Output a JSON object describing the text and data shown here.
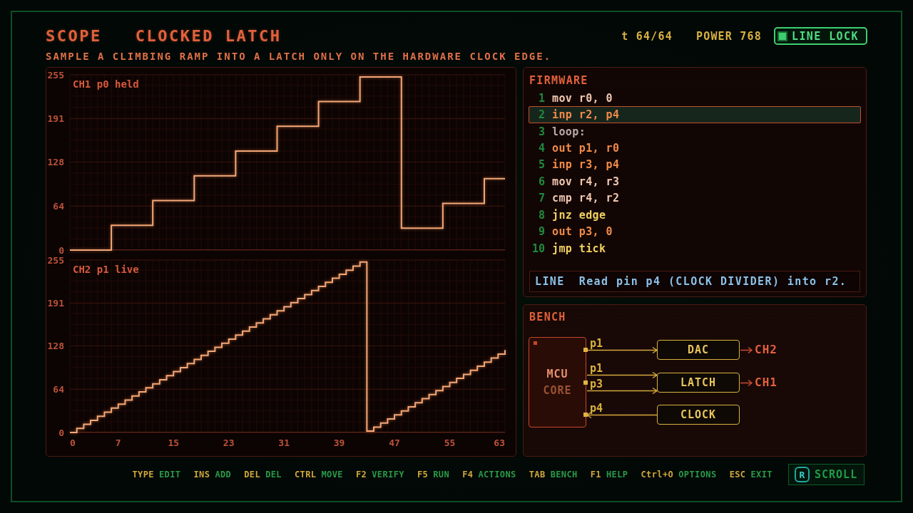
{
  "header": {
    "mode": "SCOPE",
    "title": "CLOCKED LATCH",
    "subtitle": "SAMPLE A CLIMBING RAMP INTO A LATCH ONLY ON THE HARDWARE CLOCK EDGE.",
    "tick": "t 64/64",
    "power": "POWER 768",
    "line_lock": {
      "label": "LINE LOCK",
      "on": true
    }
  },
  "scope": {
    "channels": [
      {
        "chart_data": {
          "type": "line",
          "title": "CH1 p0 held",
          "x": [
            0,
            6,
            6,
            12,
            12,
            18,
            18,
            24,
            24,
            30,
            30,
            36,
            36,
            42,
            42,
            48,
            48,
            54,
            54,
            60,
            60,
            63
          ],
          "series": [
            {
              "color": "#f4a878",
              "values": [
                0,
                0,
                36,
                36,
                72,
                72,
                108,
                108,
                144,
                144,
                180,
                180,
                216,
                216,
                252,
                252,
                32,
                32,
                68,
                68,
                104,
                104
              ]
            }
          ],
          "xlim": [
            0,
            63
          ],
          "ylim": [
            0,
            255
          ],
          "yticks": [
            0,
            64,
            128,
            191,
            255
          ],
          "grid": true
        }
      },
      {
        "chart_data": {
          "type": "line",
          "title": "CH2 p1 live",
          "x": [
            0,
            1,
            1,
            2,
            2,
            3,
            3,
            4,
            4,
            5,
            5,
            6,
            6,
            7,
            7,
            8,
            8,
            9,
            9,
            10,
            10,
            11,
            11,
            12,
            12,
            13,
            13,
            14,
            14,
            15,
            15,
            16,
            16,
            17,
            17,
            18,
            18,
            19,
            19,
            20,
            20,
            21,
            21,
            22,
            22,
            23,
            23,
            24,
            24,
            25,
            25,
            26,
            26,
            27,
            27,
            28,
            28,
            29,
            29,
            30,
            30,
            31,
            31,
            32,
            32,
            33,
            33,
            34,
            34,
            35,
            35,
            36,
            36,
            37,
            37,
            38,
            38,
            39,
            39,
            40,
            40,
            41,
            41,
            42,
            42,
            43,
            43,
            44,
            44,
            45,
            45,
            46,
            46,
            47,
            47,
            48,
            48,
            49,
            49,
            50,
            50,
            51,
            51,
            52,
            52,
            53,
            53,
            54,
            54,
            55,
            55,
            56,
            56,
            57,
            57,
            58,
            58,
            59,
            59,
            60,
            60,
            61,
            61,
            62,
            62,
            63,
            63
          ],
          "series": [
            {
              "color": "#f4a878",
              "values": [
                0,
                0,
                6,
                6,
                12,
                12,
                18,
                18,
                24,
                24,
                30,
                30,
                36,
                36,
                42,
                42,
                48,
                48,
                54,
                54,
                60,
                60,
                66,
                66,
                72,
                72,
                78,
                78,
                84,
                84,
                90,
                90,
                96,
                96,
                102,
                102,
                108,
                108,
                114,
                114,
                120,
                120,
                126,
                126,
                132,
                132,
                138,
                138,
                144,
                144,
                150,
                150,
                156,
                156,
                162,
                162,
                168,
                168,
                174,
                174,
                180,
                180,
                186,
                186,
                192,
                192,
                198,
                198,
                204,
                204,
                210,
                210,
                216,
                216,
                222,
                222,
                228,
                228,
                234,
                234,
                240,
                240,
                246,
                246,
                252,
                252,
                2,
                2,
                8,
                8,
                14,
                14,
                20,
                20,
                26,
                26,
                32,
                32,
                38,
                38,
                44,
                44,
                50,
                50,
                56,
                56,
                62,
                62,
                68,
                68,
                74,
                74,
                80,
                80,
                86,
                86,
                92,
                92,
                98,
                98,
                104,
                104,
                110,
                110,
                116,
                116,
                122
              ]
            }
          ],
          "xlim": [
            0,
            63
          ],
          "ylim": [
            0,
            255
          ],
          "yticks": [
            0,
            64,
            128,
            191,
            255
          ],
          "xticks": [
            0,
            7,
            15,
            23,
            31,
            39,
            47,
            55,
            63
          ],
          "grid": true
        }
      }
    ]
  },
  "firmware": {
    "title": "FIRMWARE",
    "lines": [
      {
        "number": "1",
        "code": "mov r0, 0",
        "kind": "data",
        "selected": false
      },
      {
        "number": "2",
        "code": "inp r2, p4",
        "kind": "io",
        "selected": true
      },
      {
        "number": "3",
        "code": "loop:",
        "kind": "label",
        "selected": false
      },
      {
        "number": "4",
        "code": "out p1, r0",
        "kind": "io",
        "selected": false
      },
      {
        "number": "5",
        "code": "inp r3, p4",
        "kind": "io",
        "selected": false
      },
      {
        "number": "6",
        "code": "mov r4, r3",
        "kind": "data",
        "selected": false
      },
      {
        "number": "7",
        "code": "cmp r4, r2",
        "kind": "data",
        "selected": false
      },
      {
        "number": "8",
        "code": "jnz edge",
        "kind": "branch",
        "selected": false
      },
      {
        "number": "9",
        "code": "out p3, 0",
        "kind": "io",
        "selected": false
      },
      {
        "number": "10",
        "code": "jmp tick",
        "kind": "branch",
        "selected": false
      }
    ],
    "hint": {
      "tag": "LINE",
      "text": "Read pin p4 (CLOCK DIVIDER) into r2."
    }
  },
  "bench": {
    "title": "BENCH",
    "core": {
      "name": "MCU",
      "subtitle": "CORE"
    },
    "blocks": [
      {
        "label": "DAC",
        "output": "CH2",
        "wires": [
          {
            "pin": "p1",
            "incoming": false
          }
        ]
      },
      {
        "label": "LATCH",
        "output": "CH1",
        "wires": [
          {
            "pin": "p1",
            "incoming": false
          },
          {
            "pin": "p3",
            "incoming": false
          }
        ]
      },
      {
        "label": "CLOCK",
        "wires": [
          {
            "pin": "p4",
            "incoming": true
          }
        ]
      }
    ]
  },
  "footer": {
    "shortcuts": [
      {
        "key": "TYPE",
        "action": "EDIT"
      },
      {
        "key": "INS",
        "action": "ADD"
      },
      {
        "key": "DEL",
        "action": "DEL"
      },
      {
        "key": "CTRL",
        "action": "MOVE"
      },
      {
        "key": "F2",
        "action": "VERIFY"
      },
      {
        "key": "F5",
        "action": "RUN"
      },
      {
        "key": "F4",
        "action": "ACTIONS"
      },
      {
        "key": "TAB",
        "action": "BENCH"
      },
      {
        "key": "F1",
        "action": "HELP"
      },
      {
        "key": "Ctrl+O",
        "action": "OPTIONS"
      },
      {
        "key": "ESC",
        "action": "EXIT"
      }
    ],
    "scroll_button": {
      "key": "R",
      "label": "SCROLL"
    }
  }
}
